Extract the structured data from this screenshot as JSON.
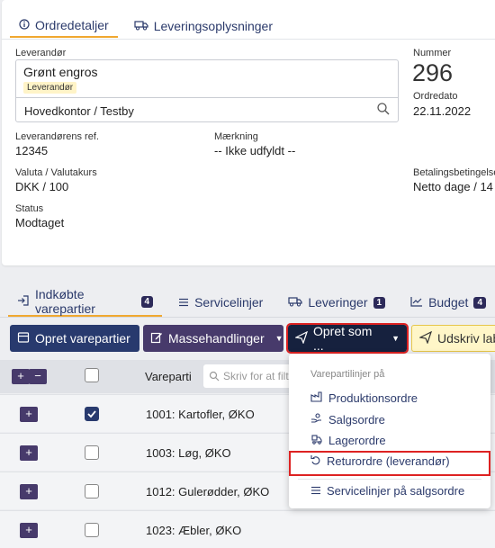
{
  "top_tabs": [
    {
      "label": "Ordredetaljer",
      "icon": "info-icon"
    },
    {
      "label": "Leveringsoplysninger",
      "icon": "truck-icon"
    }
  ],
  "supplier": {
    "label": "Leverandør",
    "name": "Grønt engros",
    "badge": "Leverandør",
    "address": "Hovedkontor / Testby"
  },
  "number": {
    "label": "Nummer",
    "value": "296"
  },
  "order_date": {
    "label": "Ordredato",
    "value": "22.11.2022"
  },
  "supplier_ref": {
    "label": "Leverandørens ref.",
    "value": "12345"
  },
  "marking": {
    "label": "Mærkning",
    "value": "-- Ikke udfyldt --"
  },
  "currency": {
    "label": "Valuta / Valutakurs",
    "value": "DKK / 100"
  },
  "payment_terms": {
    "label": "Betalingsbetingelse",
    "value": "Netto dage / 14"
  },
  "status": {
    "label": "Status",
    "value": "Modtaget"
  },
  "bottom_tabs": [
    {
      "label": "Indkøbte varepartier",
      "count": "4",
      "icon": "login-icon"
    },
    {
      "label": "Servicelinjer",
      "count": "",
      "icon": "list-icon"
    },
    {
      "label": "Leveringer",
      "count": "1",
      "icon": "truck-icon"
    },
    {
      "label": "Budget",
      "count": "4",
      "icon": "chart-icon"
    }
  ],
  "toolbar": {
    "create_lots": "Opret varepartier",
    "bulk_actions": "Massehandlinger",
    "create_as": "Opret som ...",
    "print": "Udskriv lab"
  },
  "grid": {
    "column_lot": "Vareparti",
    "search_placeholder": "Skriv for at filtrere",
    "rows": [
      {
        "name": "1001: Kartofler, ØKO",
        "checked": true
      },
      {
        "name": "1003: Løg, ØKO",
        "checked": false
      },
      {
        "name": "1012: Gulerødder, ØKO",
        "checked": false
      },
      {
        "name": "1023: Æbler, ØKO",
        "checked": false
      }
    ]
  },
  "dropdown": {
    "header": "Varepartilinjer på",
    "items": [
      {
        "label": "Produktionsordre",
        "icon": "factory-icon"
      },
      {
        "label": "Salgsordre",
        "icon": "hand-coin-icon"
      },
      {
        "label": "Lagerordre",
        "icon": "truck-loading-icon"
      },
      {
        "label": "Returordre (leverandør)",
        "icon": "undo-icon"
      },
      {
        "label": "Servicelinjer på salgsordre",
        "icon": "list-icon"
      }
    ]
  },
  "colors": {
    "navy": "#283a6e",
    "purple": "#473a6b",
    "highlight": "#d22222",
    "tab_underline": "#f0a830"
  }
}
